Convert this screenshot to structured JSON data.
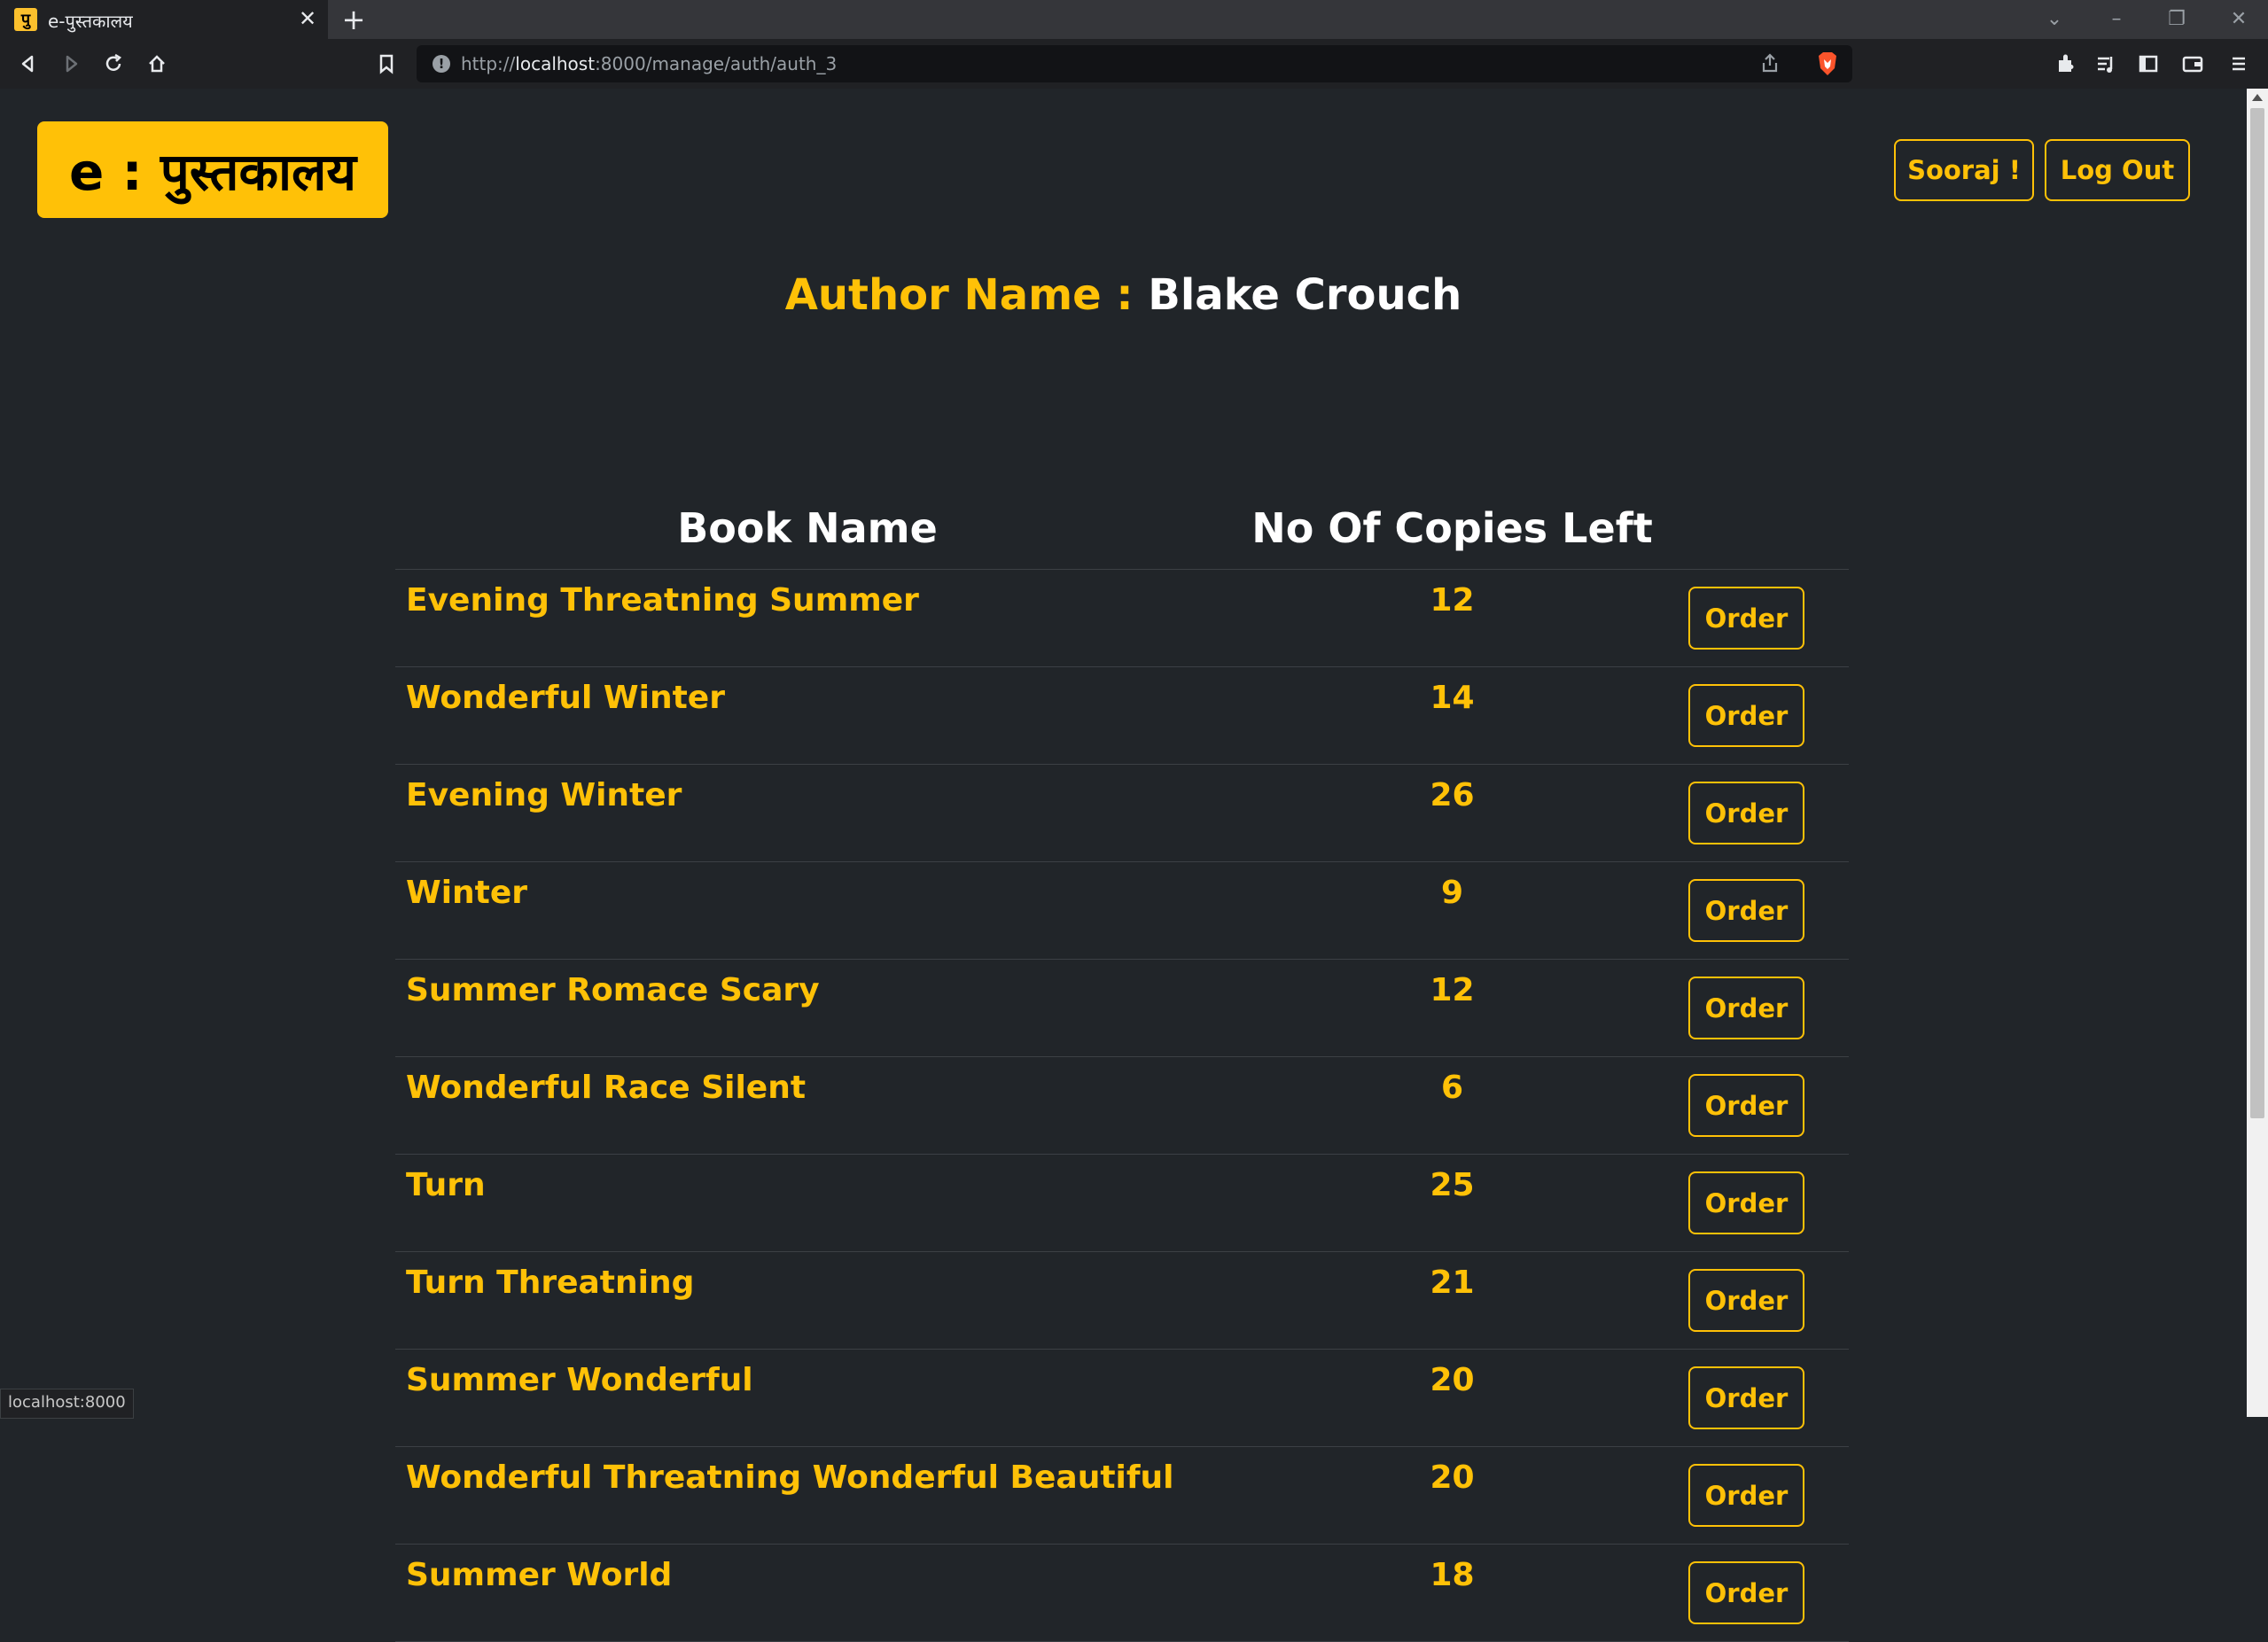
{
  "browser": {
    "tab_favicon": "पु",
    "tab_title": "e-पुस्तकालय",
    "tab_close": "✕",
    "new_tab": "+",
    "url_prefix": "http://",
    "url_host": "localhost",
    "url_rest": ":8000/manage/auth/auth_3",
    "status_url": "localhost:8000"
  },
  "header": {
    "brand": "e : पुस्तकालय",
    "user_button": "Sooraj !",
    "logout_button": "Log Out"
  },
  "author": {
    "label": "Author Name : ",
    "name": "Blake Crouch"
  },
  "table": {
    "headers": [
      "Book Name",
      "No Of Copies Left"
    ],
    "order_label": "Order",
    "rows": [
      {
        "name": "Evening Threatning Summer",
        "copies": "12"
      },
      {
        "name": "Wonderful Winter",
        "copies": "14"
      },
      {
        "name": "Evening Winter",
        "copies": "26"
      },
      {
        "name": "Winter",
        "copies": "9"
      },
      {
        "name": "Summer Romace Scary",
        "copies": "12"
      },
      {
        "name": "Wonderful Race Silent",
        "copies": "6"
      },
      {
        "name": "Turn",
        "copies": "25"
      },
      {
        "name": "Turn Threatning",
        "copies": "21"
      },
      {
        "name": "Summer Wonderful",
        "copies": "20"
      },
      {
        "name": "Wonderful Threatning Wonderful Beautiful",
        "copies": "20"
      },
      {
        "name": "Summer World",
        "copies": "18"
      }
    ]
  },
  "colors": {
    "accent": "#ffc107",
    "background": "#212529"
  }
}
